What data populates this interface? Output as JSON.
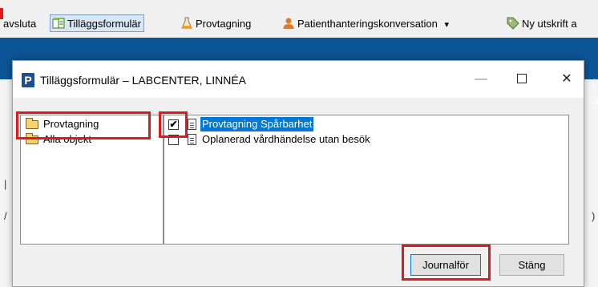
{
  "toolbar": {
    "items": [
      {
        "label": "avsluta",
        "icon": "truncated-icon"
      },
      {
        "label": "Tilläggsformulär",
        "icon": "forms-icon"
      },
      {
        "label": "Provtagning",
        "icon": "flask-icon"
      },
      {
        "label": "Patienthanteringskonversation",
        "icon": "person-icon",
        "dropdown": "▾"
      },
      {
        "label": "Ny utskrift a",
        "icon": "tag-icon"
      }
    ]
  },
  "dialog": {
    "app_icon_letter": "P",
    "title": "Tilläggsformulär – LABCENTER, LINNÉA",
    "window_buttons": {
      "minimize": "—",
      "close": "✕"
    },
    "folders": [
      {
        "label": "Provtagning"
      },
      {
        "label": "Alla objekt"
      }
    ],
    "items": [
      {
        "label": "Provtagning Spårbarhet",
        "checked": true,
        "check_glyph": "✔",
        "selected": true
      },
      {
        "label": "Oplanerad vårdhändelse utan besök",
        "checked": false,
        "check_glyph": "",
        "selected": false
      }
    ],
    "buttons": {
      "journal": "Journalför",
      "close": "Stäng"
    }
  },
  "colors": {
    "highlight": "#e0191b",
    "app_blue": "#0b5596",
    "selection": "#0078d7"
  }
}
